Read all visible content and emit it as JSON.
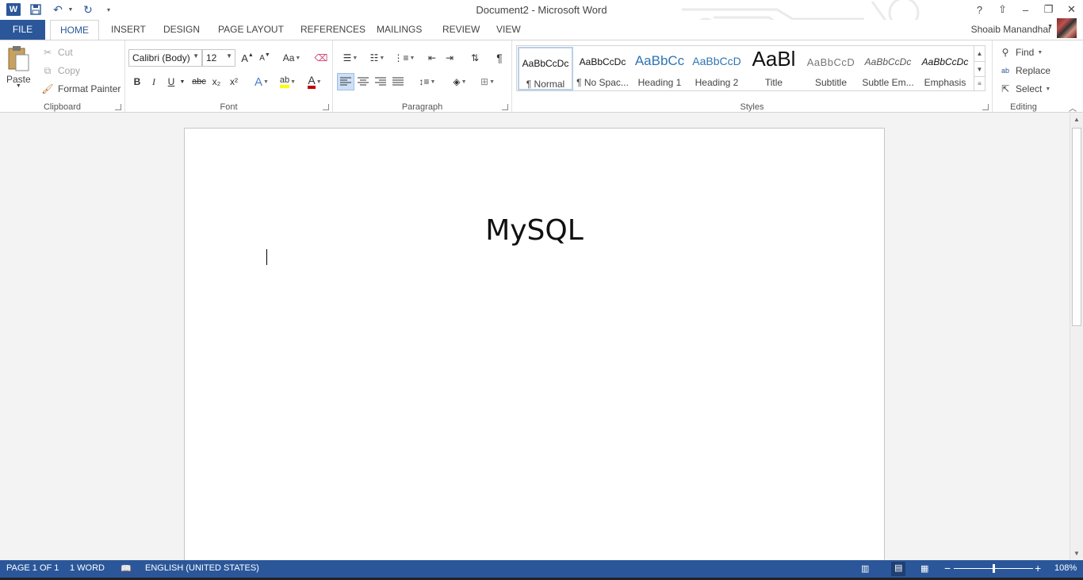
{
  "window": {
    "title": "Document2 - Microsoft Word",
    "help": "?",
    "minimize": "–",
    "restore": "❐",
    "close": "✕"
  },
  "qat": {
    "word_icon": "W",
    "save_icon": "save-icon",
    "undo_icon": "undo-icon",
    "redo_icon": "repeat-icon"
  },
  "tabs": {
    "file": "FILE",
    "items": [
      "HOME",
      "INSERT",
      "DESIGN",
      "PAGE LAYOUT",
      "REFERENCES",
      "MAILINGS",
      "REVIEW",
      "VIEW"
    ],
    "user": "Shoaib Manandhar"
  },
  "clipboard": {
    "paste": "Paste",
    "cut": "Cut",
    "copy": "Copy",
    "format_painter": "Format Painter",
    "label": "Clipboard"
  },
  "font": {
    "family": "Calibri (Body)",
    "size": "12",
    "label": "Font",
    "bold": "B",
    "italic": "I",
    "underline": "U",
    "strike": "abc",
    "sub": "x₂",
    "sup": "x²",
    "grow": "A",
    "shrink": "A",
    "case": "Aa",
    "color_accent": "#c00000",
    "highlight_accent": "#ffff00"
  },
  "paragraph": {
    "label": "Paragraph",
    "pilcrow": "¶"
  },
  "styles": {
    "label": "Styles",
    "items": [
      {
        "sample": "AaBbCcDc",
        "name": "¶ Normal"
      },
      {
        "sample": "AaBbCcDc",
        "name": "¶ No Spac..."
      },
      {
        "sample": "AaBbCc",
        "name": "Heading 1"
      },
      {
        "sample": "AaBbCcD",
        "name": "Heading 2"
      },
      {
        "sample": "AaBl",
        "name": "Title"
      },
      {
        "sample": "AaBbCcD",
        "name": "Subtitle"
      },
      {
        "sample": "AaBbCcDc",
        "name": "Subtle Em..."
      },
      {
        "sample": "AaBbCcDc",
        "name": "Emphasis"
      }
    ]
  },
  "editing": {
    "find": "Find",
    "replace": "Replace",
    "select": "Select",
    "label": "Editing"
  },
  "document": {
    "heading": "MySQL"
  },
  "status": {
    "page": "PAGE 1 OF 1",
    "words": "1 WORD",
    "language": "ENGLISH (UNITED STATES)",
    "zoom": "108%"
  }
}
